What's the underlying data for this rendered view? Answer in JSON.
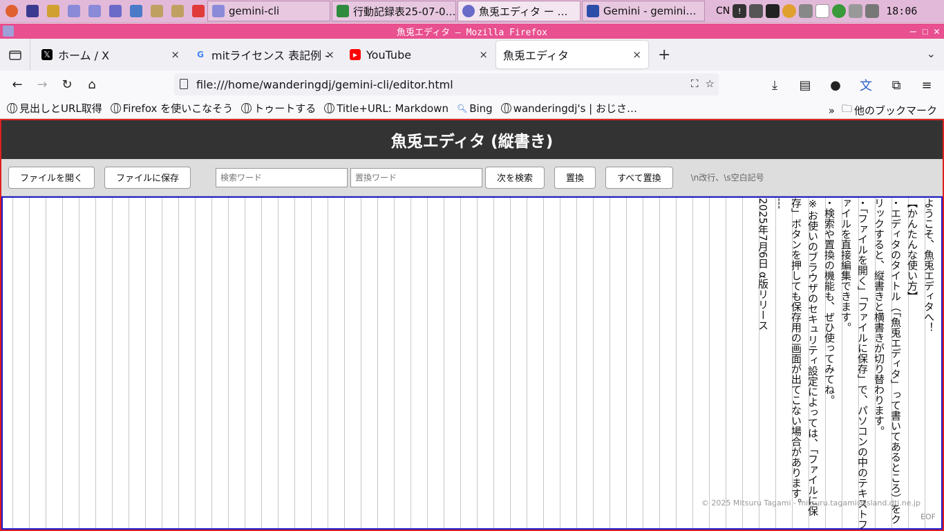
{
  "taskbar": {
    "tasks": [
      {
        "label": "gemini-cli"
      },
      {
        "label": "行動記録表25-07-0…"
      },
      {
        "label": "魚兎エディタ ー …"
      },
      {
        "label": "Gemini - gemini…"
      }
    ],
    "lang": "CN",
    "clock": "18:06"
  },
  "window": {
    "title": "魚兎エディタ — Mozilla Firefox",
    "controls": [
      "—",
      "☐",
      "✕"
    ]
  },
  "browser": {
    "tabs": [
      {
        "label": "ホーム / X",
        "close": "×"
      },
      {
        "label": "mitライセンス 表記例 -",
        "close": "×"
      },
      {
        "label": "YouTube",
        "close": "×"
      },
      {
        "label": "魚兎エディタ",
        "close": "×"
      }
    ],
    "new_tab": "+",
    "url": "file:///home/wanderingdj/gemini-cli/editor.html",
    "bookmarks": [
      "見出しとURL取得",
      "Firefox を使いこなそう",
      "トゥートする",
      "Title+URL: Markdown",
      "Bing",
      "wanderingdj's | おじさ…"
    ],
    "other_bookmarks": "他のブックマーク"
  },
  "app": {
    "title": "魚兎エディタ (縦書き)",
    "open_label": "ファイルを開く",
    "save_label": "ファイルに保存",
    "search_placeholder": "検索ワード",
    "replace_placeholder": "置換ワード",
    "find_next_label": "次を検索",
    "replace_label": "置換",
    "replace_all_label": "すべて置換",
    "hint": "\\n改行、\\s空白記号",
    "lines": [
      "",
      "ようこそ、魚兎エディタへ！",
      "",
      "【かんたんな使い方】",
      "・エディタのタイトル（「魚兎エディタ」って書いてあるところ）をクリックすると、縦書きと横書きが切り替わります。",
      "・「ファイルを開く」「ファイルに保存」で、パソコンの中のテキストファイルを直接編集できます。",
      "・検索や置換の機能も、ぜひ使ってみてね。",
      "",
      "※お使いのブラウザのセキュリティ設定によっては、「ファイルに保存」ボタンを押しても保存用の画面が出てこない場合があります。",
      "",
      "---",
      "2025年7月6日 α版リリース"
    ],
    "footer": "© 2025 Mitsuru Tagami - mitsuru.tagami@island.dti.ne.jp",
    "eof": "EOF"
  },
  "colors": {
    "taskbar": "#e3b9d9",
    "window_title": "#e8508f",
    "app_header": "#333333",
    "editor_border": "#1a1acc",
    "page_border": "#e02020"
  }
}
